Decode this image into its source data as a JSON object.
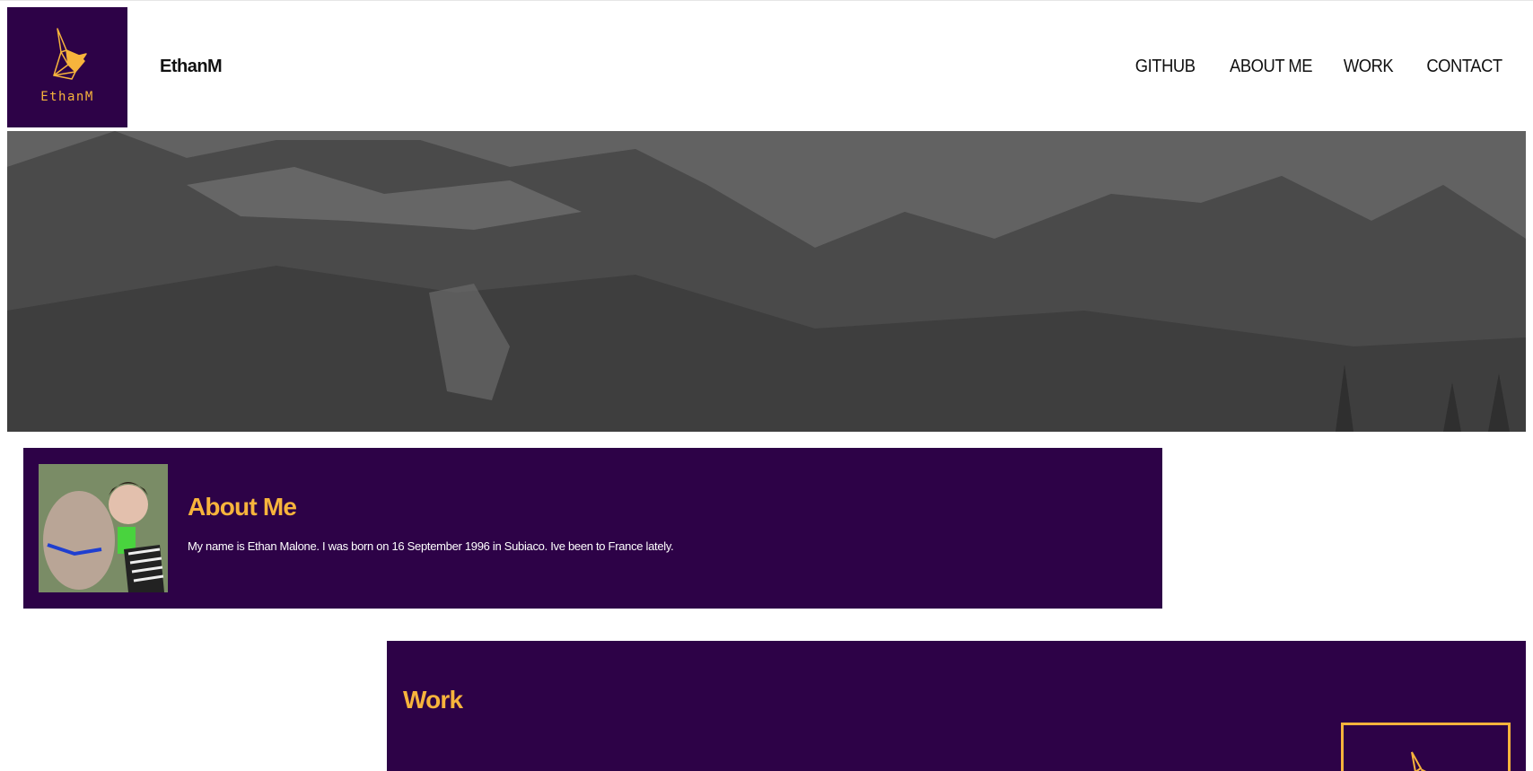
{
  "brand": {
    "logo_text": "EthanM",
    "site_name": "EthanM"
  },
  "nav": {
    "items": [
      "GITHUB",
      "ABOUT ME",
      "WORK",
      "CONTACT"
    ]
  },
  "about": {
    "heading": "About Me",
    "text": "My name is Ethan Malone. I was born on 16 September 1996 in Subiaco. Ive been to France lately."
  },
  "work": {
    "heading": "Work"
  },
  "colors": {
    "brand_purple": "#2d0247",
    "accent_gold": "#f7b43c"
  }
}
